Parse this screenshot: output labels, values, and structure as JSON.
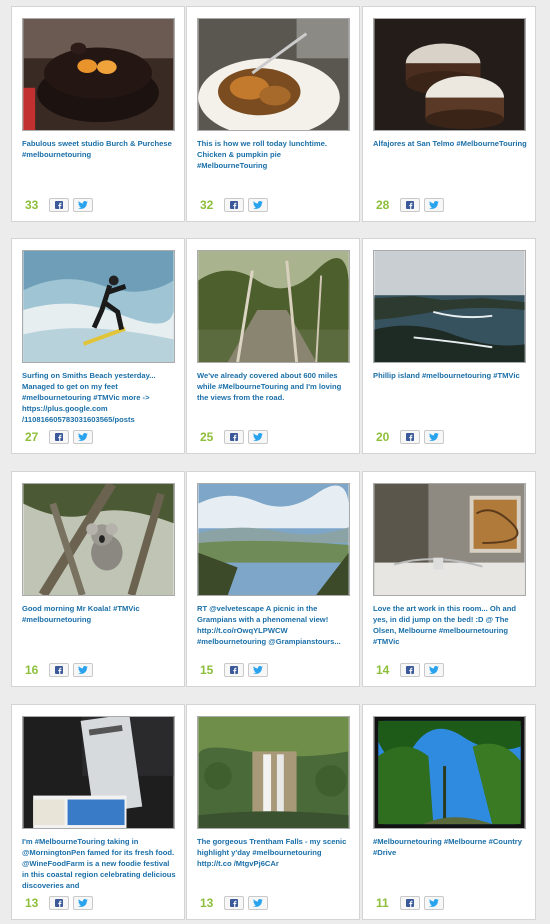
{
  "posts": [
    {
      "caption": "Fabulous sweet studio Burch & Purchese #melbournetouring",
      "count": "33",
      "image": "chocolate-dessert"
    },
    {
      "caption": "This is how we roll today lunchtime. Chicken & pumpkin pie #MelbourneTouring",
      "count": "32",
      "image": "pie-plate"
    },
    {
      "caption": "Alfajores at San Telmo #MelbourneTouring",
      "count": "28",
      "image": "alfajores"
    },
    {
      "caption": "Surfing on Smiths Beach yesterday... Managed to get on my feet #melbournetouring #TMVic more -> https://plus.google.com /110816605783031603565/posts",
      "count": "27",
      "image": "surfer"
    },
    {
      "caption": "We've already covered about 600 miles while #MelbourneTouring and I'm loving the views from the road.",
      "count": "25",
      "image": "forest-road"
    },
    {
      "caption": "Phillip island #melbournetouring #TMVic",
      "count": "20",
      "image": "coastline"
    },
    {
      "caption": "Good morning Mr Koala! #TMVic #melbournetouring",
      "count": "16",
      "image": "koala"
    },
    {
      "caption": "RT @velvetescape A picnic in the Grampians with a phenomenal view! http://t.co/rOwqYLPWCW #melbournetouring @Grampianstours...",
      "count": "15",
      "image": "grampians-view"
    },
    {
      "caption": "Love the art work in this room... Oh and yes, in did jump on the bed! :D @ The Olsen, Melbourne #melbournetouring #TMVic",
      "count": "14",
      "image": "hotel-room"
    },
    {
      "caption": "I'm #MelbourneTouring taking in @MorningtonPen famed for its fresh food. @WineFoodFarm is a new foodie festival in this coastal region celebrating delicious discoveries and",
      "count": "13",
      "image": "brochures"
    },
    {
      "caption": "The gorgeous Trentham Falls - my scenic highlight y'day #melbournetouring http://t.co /MtgvPj6CAr",
      "count": "13",
      "image": "waterfall"
    },
    {
      "caption": "#Melbournetouring #Melbourne #Country #Drive",
      "count": "11",
      "image": "trees-sky"
    }
  ],
  "share": {
    "facebook_icon": "facebook-icon",
    "twitter_icon": "twitter-icon"
  },
  "colors": {
    "link": "#1a6fa8",
    "count": "#8dbf3b",
    "background": "#ececec"
  }
}
